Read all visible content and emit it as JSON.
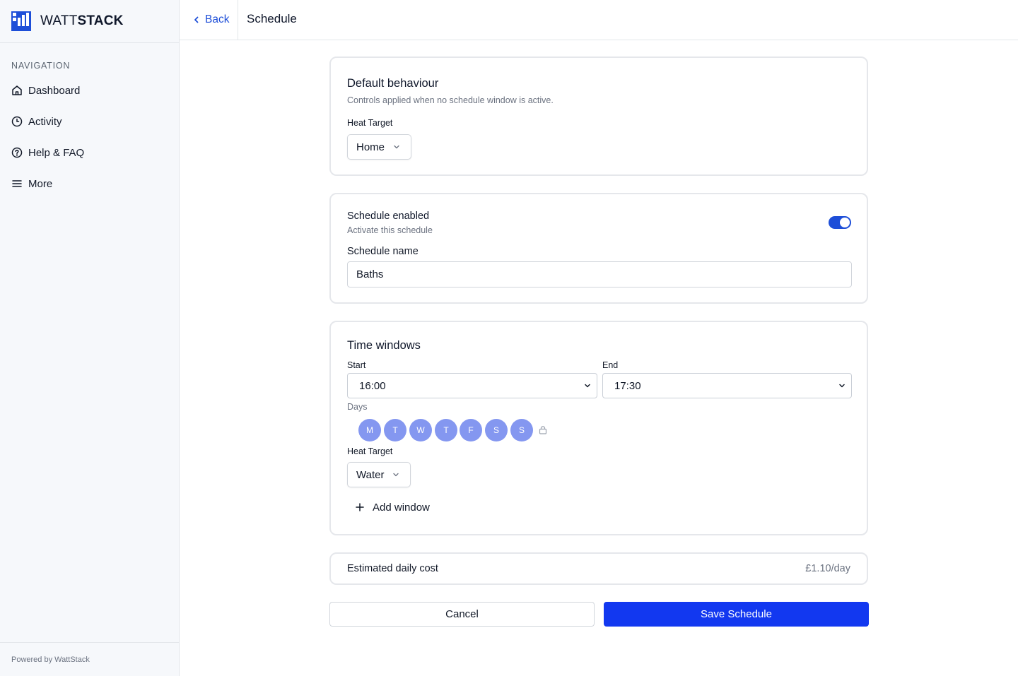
{
  "brand": {
    "name_light": "WATT",
    "name_bold": "STACK"
  },
  "sidebar": {
    "heading": "NAVIGATION",
    "items": [
      {
        "label": "Dashboard",
        "icon": "home-icon"
      },
      {
        "label": "Activity",
        "icon": "clock-icon"
      },
      {
        "label": "Help & FAQ",
        "icon": "help-circle-icon"
      },
      {
        "label": "More",
        "icon": "menu-icon"
      }
    ],
    "footer": "Powered by WattStack"
  },
  "topbar": {
    "back_label": "Back",
    "title": "Schedule"
  },
  "default_behaviour": {
    "title": "Default behaviour",
    "description": "Controls applied when no schedule window is active.",
    "heat_target_label": "Heat Target",
    "heat_target_value": "Home"
  },
  "schedule": {
    "enabled_label": "Schedule enabled",
    "enabled_description": "Activate this schedule",
    "enabled": true,
    "name_label": "Schedule name",
    "name_value": "Baths"
  },
  "time_windows": {
    "title": "Time windows",
    "start_label": "Start",
    "start_value": "16:00",
    "end_label": "End",
    "end_value": "17:30",
    "days_label": "Days",
    "days": [
      "M",
      "T",
      "W",
      "T",
      "F",
      "S",
      "S"
    ],
    "heat_target_label": "Heat Target",
    "heat_target_value": "Water",
    "add_window_label": "Add window"
  },
  "cost": {
    "label": "Estimated daily cost",
    "value": "£1.10/day"
  },
  "actions": {
    "cancel_label": "Cancel",
    "save_label": "Save Schedule"
  },
  "colors": {
    "accent": "#1238f0",
    "day_chip": "#8497f0",
    "toggle": "#1d4ed8"
  }
}
